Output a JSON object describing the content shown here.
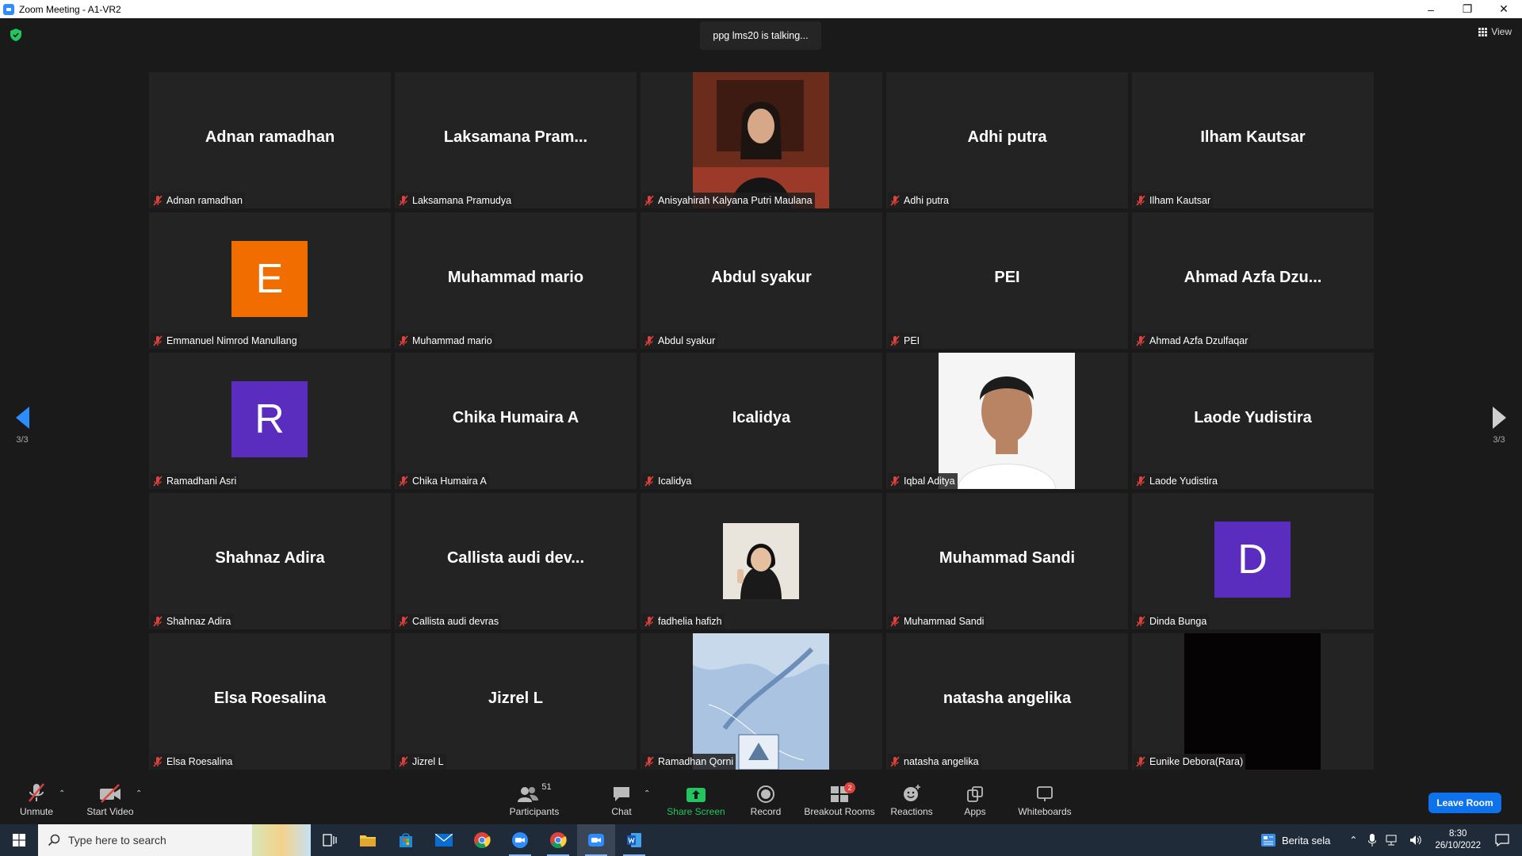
{
  "window": {
    "title": "Zoom Meeting - A1-VR2"
  },
  "meeting": {
    "talking_text": "ppg lms20 is talking...",
    "view_label": "View",
    "page_left": "3/3",
    "page_right": "3/3",
    "participants": [
      {
        "big": "Adnan ramadhan",
        "name": "Adnan ramadhan",
        "type": "text"
      },
      {
        "big": "Laksamana  Pram...",
        "name": "Laksamana Pramudya",
        "type": "text"
      },
      {
        "big": "",
        "name": "Anisyahirah Kalyana Putri Maulana",
        "type": "photo-woman"
      },
      {
        "big": "Adhi putra",
        "name": "Adhi putra",
        "type": "text"
      },
      {
        "big": "Ilham Kautsar",
        "name": "Ilham Kautsar",
        "type": "text"
      },
      {
        "big": "E",
        "name": "Emmanuel Nimrod Manullang",
        "type": "letter",
        "color": "#f26d00"
      },
      {
        "big": "Muhammad mario",
        "name": "Muhammad mario",
        "type": "text"
      },
      {
        "big": "Abdul syakur",
        "name": "Abdul syakur",
        "type": "text"
      },
      {
        "big": "PEI",
        "name": "PEI",
        "type": "text"
      },
      {
        "big": "Ahmad  Azfa  Dzu...",
        "name": "Ahmad Azfa Dzulfaqar",
        "type": "text"
      },
      {
        "big": "R",
        "name": "Ramadhani Asri",
        "type": "letter",
        "color": "#5b2dbf"
      },
      {
        "big": "Chika Humaira A",
        "name": "Chika Humaira A",
        "type": "text"
      },
      {
        "big": "Icalidya",
        "name": "Icalidya",
        "type": "text"
      },
      {
        "big": "",
        "name": "Iqbal Aditya",
        "type": "photo-man"
      },
      {
        "big": "Laode Yudistira",
        "name": "Laode Yudistira",
        "type": "text"
      },
      {
        "big": "Shahnaz Adira",
        "name": "Shahnaz Adira",
        "type": "text"
      },
      {
        "big": "Callista audi dev...",
        "name": "Callista audi devras",
        "type": "text"
      },
      {
        "big": "",
        "name": "fadhelia hafizh",
        "type": "photo-small"
      },
      {
        "big": "Muhammad Sandi",
        "name": "Muhammad Sandi",
        "type": "text"
      },
      {
        "big": "D",
        "name": "Dinda Bunga",
        "type": "letter",
        "color": "#5b2dbf"
      },
      {
        "big": "Elsa Roesalina",
        "name": "Elsa Roesalina",
        "type": "text"
      },
      {
        "big": "Jizrel L",
        "name": "Jizrel L",
        "type": "text"
      },
      {
        "big": "",
        "name": "Ramadhan Qorni",
        "type": "photo-map"
      },
      {
        "big": "natasha angelika",
        "name": "natasha angelika",
        "type": "text"
      },
      {
        "big": "",
        "name": "Eunike Debora(Rara)",
        "type": "photo-black"
      }
    ]
  },
  "toolbar": {
    "unmute": "Unmute",
    "start_video": "Start Video",
    "participants": "Participants",
    "participants_count": "51",
    "chat": "Chat",
    "share_screen": "Share Screen",
    "record": "Record",
    "breakout_rooms": "Breakout Rooms",
    "breakout_badge": "2",
    "reactions": "Reactions",
    "apps": "Apps",
    "whiteboards": "Whiteboards",
    "leave_room": "Leave Room"
  },
  "taskbar": {
    "search_placeholder": "Type here to search",
    "news": "Berita sela",
    "time": "8:30",
    "date": "26/10/2022"
  },
  "colors": {
    "accent": "#0e72ed",
    "share_green": "#23c55e",
    "muted_red": "#e0413b"
  }
}
